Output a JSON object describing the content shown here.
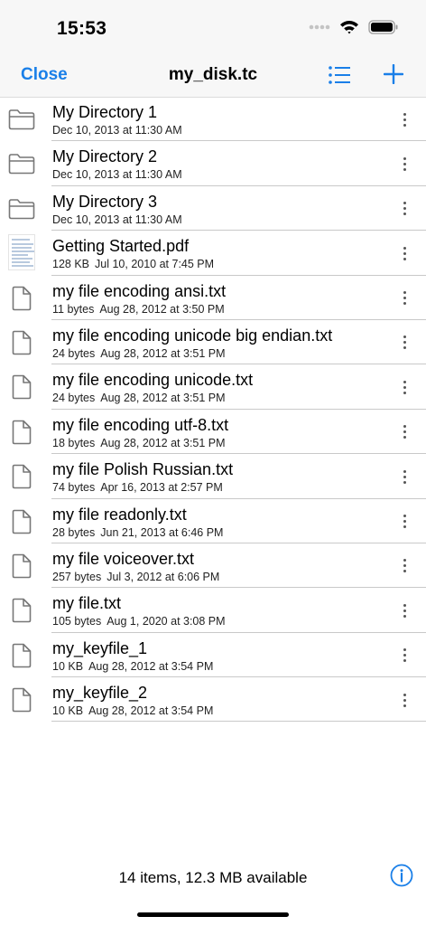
{
  "status_bar": {
    "time": "15:53"
  },
  "nav": {
    "close_label": "Close",
    "title": "my_disk.tc",
    "accent_color": "#1a7fe8",
    "list_icon": "list-icon",
    "add_icon": "plus-icon"
  },
  "files": [
    {
      "name": "My Directory 1",
      "size": "",
      "date": "Dec 10, 2013 at 11:30 AM",
      "type": "folder"
    },
    {
      "name": "My Directory 2",
      "size": "",
      "date": "Dec 10, 2013 at 11:30 AM",
      "type": "folder"
    },
    {
      "name": "My Directory 3",
      "size": "",
      "date": "Dec 10, 2013 at 11:30 AM",
      "type": "folder"
    },
    {
      "name": "Getting Started.pdf",
      "size": "128 KB",
      "date": "Jul 10, 2010 at 7:45 PM",
      "type": "pdf"
    },
    {
      "name": "my file encoding ansi.txt",
      "size": "11 bytes",
      "date": "Aug 28, 2012 at 3:50 PM",
      "type": "file"
    },
    {
      "name": "my file encoding unicode big endian.txt",
      "size": "24 bytes",
      "date": "Aug 28, 2012 at 3:51 PM",
      "type": "file"
    },
    {
      "name": "my file encoding unicode.txt",
      "size": "24 bytes",
      "date": "Aug 28, 2012 at 3:51 PM",
      "type": "file"
    },
    {
      "name": "my file encoding utf-8.txt",
      "size": "18 bytes",
      "date": "Aug 28, 2012 at 3:51 PM",
      "type": "file"
    },
    {
      "name": "my file Polish Russian.txt",
      "size": "74 bytes",
      "date": "Apr 16, 2013 at 2:57 PM",
      "type": "file"
    },
    {
      "name": "my file readonly.txt",
      "size": "28 bytes",
      "date": "Jun 21, 2013 at 6:46 PM",
      "type": "file"
    },
    {
      "name": "my file voiceover.txt",
      "size": "257 bytes",
      "date": "Jul 3, 2012 at 6:06 PM",
      "type": "file"
    },
    {
      "name": "my file.txt",
      "size": "105 bytes",
      "date": "Aug 1, 2020 at 3:08 PM",
      "type": "file"
    },
    {
      "name": "my_keyfile_1",
      "size": "10 KB",
      "date": "Aug 28, 2012 at 3:54 PM",
      "type": "file"
    },
    {
      "name": "my_keyfile_2",
      "size": "10 KB",
      "date": "Aug 28, 2012 at 3:54 PM",
      "type": "file"
    }
  ],
  "footer": {
    "summary": "14 items, 12.3 MB available",
    "info_icon": "info-icon"
  }
}
